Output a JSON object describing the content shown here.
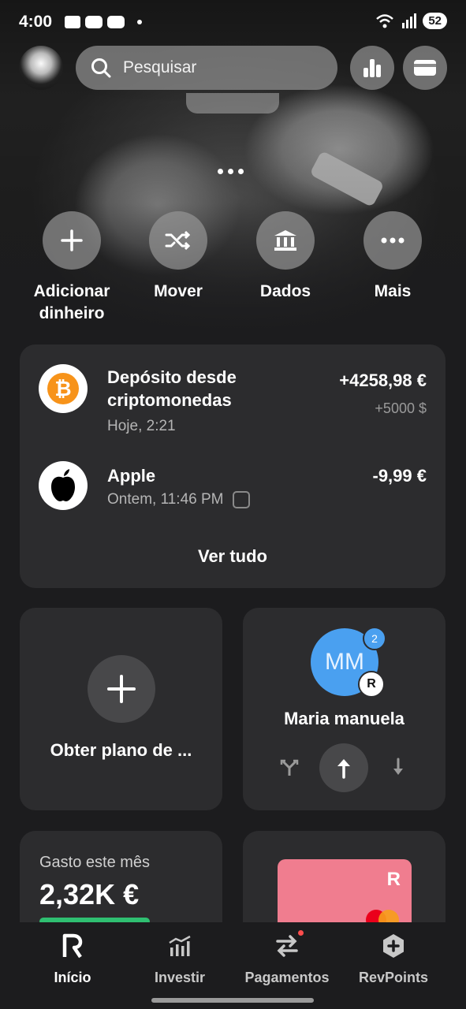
{
  "status_bar": {
    "time": "4:00",
    "battery": "52"
  },
  "search": {
    "placeholder": "Pesquisar"
  },
  "actions": [
    {
      "label": "Adicionar dinheiro",
      "icon": "plus-icon"
    },
    {
      "label": "Mover",
      "icon": "shuffle-icon"
    },
    {
      "label": "Dados",
      "icon": "bank-icon"
    },
    {
      "label": "Mais",
      "icon": "more-icon"
    }
  ],
  "transactions": [
    {
      "title": "Depósito desde criptomonedas",
      "time": "Hoje, 2:21",
      "amount": "+4258,98 €",
      "secondary_amount": "+5000 $",
      "icon": "bitcoin-icon"
    },
    {
      "title": "Apple",
      "time": "Ontem, 11:46 PM",
      "amount": "-9,99 €",
      "icon": "apple-icon"
    }
  ],
  "see_all_label": "Ver tudo",
  "plan": {
    "label": "Obter plano de ..."
  },
  "contact": {
    "initials": "MM",
    "badge_count": "2",
    "name": "Maria manuela"
  },
  "spending": {
    "label": "Gasto este mês",
    "value": "2,32K €"
  },
  "nav": [
    {
      "label": "Início",
      "icon": "revolut-icon",
      "active": true
    },
    {
      "label": "Investir",
      "icon": "invest-chart-icon",
      "active": false
    },
    {
      "label": "Pagamentos",
      "icon": "transfer-arrows-icon",
      "active": false
    },
    {
      "label": "RevPoints",
      "icon": "revpoints-icon",
      "active": false
    }
  ],
  "colors": {
    "background": "#1c1c1e",
    "card": "#2c2c2e",
    "contact_avatar": "#4aa0f0",
    "card_pink": "#f07d8f"
  }
}
